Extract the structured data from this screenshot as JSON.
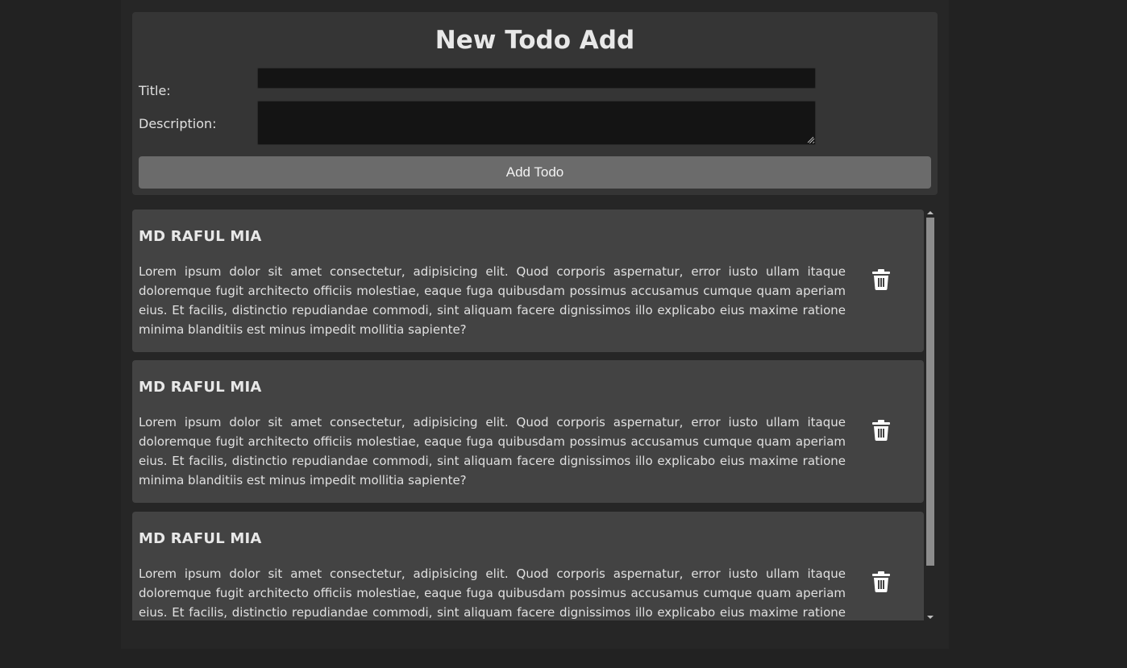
{
  "form": {
    "heading": "New Todo Add",
    "title_label": "Title:",
    "title_value": "",
    "description_label": "Description:",
    "description_value": "",
    "add_button_label": "Add Todo"
  },
  "todos": [
    {
      "title": "MD RAFUL MIA",
      "description": "Lorem ipsum dolor sit amet consectetur, adipisicing elit. Quod corporis aspernatur, error iusto ullam itaque doloremque fugit architecto officiis molestiae, eaque fuga quibusdam possimus accusamus cumque quam aperiam eius. Et facilis, distinctio repudiandae commodi, sint aliquam facere dignissimos illo explicabo eius maxime ratione minima blanditiis est minus impedit mollitia sapiente?"
    },
    {
      "title": "MD RAFUL MIA",
      "description": "Lorem ipsum dolor sit amet consectetur, adipisicing elit. Quod corporis aspernatur, error iusto ullam itaque doloremque fugit architecto officiis molestiae, eaque fuga quibusdam possimus accusamus cumque quam aperiam eius. Et facilis, distinctio repudiandae commodi, sint aliquam facere dignissimos illo explicabo eius maxime ratione minima blanditiis est minus impedit mollitia sapiente?"
    },
    {
      "title": "MD RAFUL MIA",
      "description": "Lorem ipsum dolor sit amet consectetur, adipisicing elit. Quod corporis aspernatur, error iusto ullam itaque doloremque fugit architecto officiis molestiae, eaque fuga quibusdam possimus accusamus cumque quam aperiam eius. Et facilis, distinctio repudiandae commodi, sint aliquam facere dignissimos illo explicabo eius maxime ratione minima blanditiis est minus impedit mollitia sapiente?"
    }
  ],
  "icons": {
    "delete": "trash-icon"
  },
  "colors": {
    "page_background": "#222222",
    "form_background": "#353535",
    "card_background": "#434343",
    "input_background": "#141414",
    "button_background": "#6b6b6b",
    "text": "#e6e6e6"
  }
}
